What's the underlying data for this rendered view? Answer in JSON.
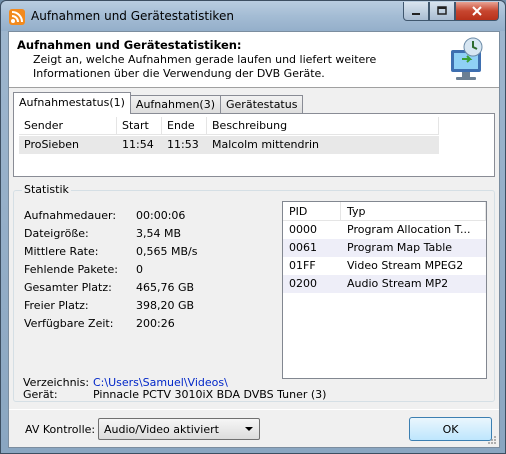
{
  "window": {
    "title": "Aufnahmen und Gerätestatistiken",
    "app_icon": "rss-feed-icon"
  },
  "header": {
    "title": "Aufnahmen und Gerätestatistiken:",
    "description": "Zeigt an, welche Aufnahmen gerade laufen und liefert weitere Informationen über die Verwendung der DVB Geräte.",
    "icon": "recording-monitor-icon"
  },
  "tabs": [
    {
      "label": "Aufnahmestatus(1)",
      "active": true
    },
    {
      "label": "Aufnahmen(3)",
      "active": false
    },
    {
      "label": "Gerätestatus",
      "active": false
    }
  ],
  "recordings": {
    "columns": [
      "Sender",
      "Start",
      "Ende",
      "Beschreibung"
    ],
    "rows": [
      [
        "ProSieben",
        "11:54",
        "11:53",
        "Malcolm mittendrin"
      ]
    ]
  },
  "statistik": {
    "legend": "Statistik",
    "items": [
      {
        "label": "Aufnahmedauer:",
        "value": "00:00:06"
      },
      {
        "label": "Dateigröße:",
        "value": "3,54 MB"
      },
      {
        "label": "Mittlere Rate:",
        "value": "0,565 MB/s"
      },
      {
        "label": "Fehlende Pakete:",
        "value": "0"
      },
      {
        "label": "Gesamter Platz:",
        "value": "465,76 GB"
      },
      {
        "label": "Freier Platz:",
        "value": "398,20 GB"
      },
      {
        "label": "Verfügbare Zeit:",
        "value": "200:26"
      }
    ],
    "pid_columns": [
      "PID",
      "Typ"
    ],
    "pids": [
      [
        "0000",
        "Program Allocation T..."
      ],
      [
        "0061",
        "Program Map Table"
      ],
      [
        "01FF",
        "Video Stream MPEG2"
      ],
      [
        "0200",
        "Audio Stream MP2"
      ]
    ]
  },
  "info": {
    "verzeichnis_label": "Verzeichnis:",
    "verzeichnis_value": "C:\\Users\\Samuel\\Videos\\",
    "geraet_label": "Gerät:",
    "geraet_value": "Pinnacle PCTV 3010iX BDA DVBS Tuner (3)"
  },
  "footer": {
    "av_label": "AV Kontrolle:",
    "av_selected": "Audio/Video aktiviert",
    "ok_label": "OK"
  },
  "colors": {
    "link": "#0026c8",
    "close_button": "#c7462f"
  }
}
